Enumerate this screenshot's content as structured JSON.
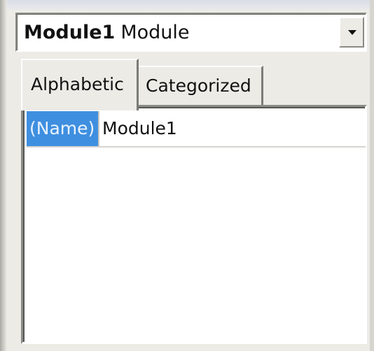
{
  "object_selector": {
    "name": "Module1",
    "type": "Module"
  },
  "tabs": [
    {
      "label": "Alphabetic",
      "active": true
    },
    {
      "label": "Categorized",
      "active": false
    }
  ],
  "properties": [
    {
      "name": "(Name)",
      "value": "Module1",
      "selected": true
    }
  ],
  "colors": {
    "selection": "#3f8fe0",
    "panel": "#ecebe6"
  },
  "icons": {
    "combo_arrow": "chevron-down-icon"
  }
}
